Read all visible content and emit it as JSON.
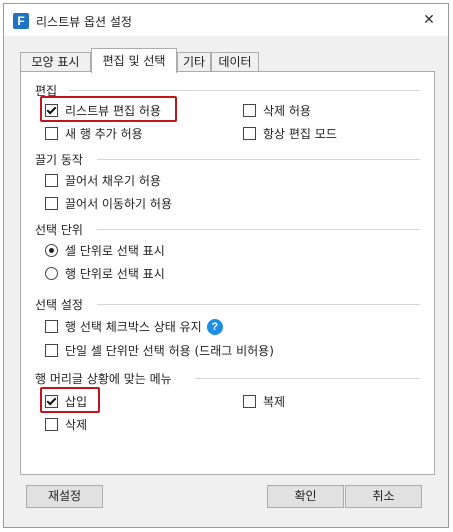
{
  "window": {
    "title": "리스트뷰 옵션 설정",
    "app_icon": "F",
    "close_icon": "✕"
  },
  "tabs": [
    {
      "label": "모양 표시",
      "active": false
    },
    {
      "label": "편집 및 선택",
      "active": true
    },
    {
      "label": "기타",
      "active": false
    },
    {
      "label": "데이터",
      "active": false
    }
  ],
  "sections": {
    "edit": {
      "title": "편집",
      "items": [
        {
          "label": "리스트뷰 편집 허용",
          "checked": true
        },
        {
          "label": "삭제 허용",
          "checked": false
        },
        {
          "label": "새 행 추가 허용",
          "checked": false
        },
        {
          "label": "항상 편집 모드",
          "checked": false
        }
      ]
    },
    "drag": {
      "title": "끌기 동작",
      "items": [
        {
          "label": "끌어서 채우기 허용",
          "checked": false
        },
        {
          "label": "끌어서 이동하기 허용",
          "checked": false
        }
      ]
    },
    "selection_unit": {
      "title": "선택 단위",
      "options": [
        {
          "label": "셀 단위로 선택 표시",
          "selected": true
        },
        {
          "label": "행 단위로 선택 표시",
          "selected": false
        }
      ]
    },
    "selection_settings": {
      "title": "선택 설정",
      "items": [
        {
          "label": "행 선택 체크박스 상태 유지",
          "checked": false
        },
        {
          "label": "단일 셀 단위만 선택 허용 (드래그 비허용)",
          "checked": false
        }
      ],
      "help_icon": "?"
    },
    "row_header_menu": {
      "title": "행 머리글 상황에 맞는 메뉴",
      "items": [
        {
          "label": "삽입",
          "checked": true
        },
        {
          "label": "복제",
          "checked": false
        },
        {
          "label": "삭제",
          "checked": false
        }
      ]
    }
  },
  "buttons": {
    "reset": "재설정",
    "ok": "확인",
    "cancel": "취소"
  },
  "colors": {
    "highlight": "#c0151c",
    "accent": "#1f72c6",
    "help": "#1e8ee3"
  }
}
